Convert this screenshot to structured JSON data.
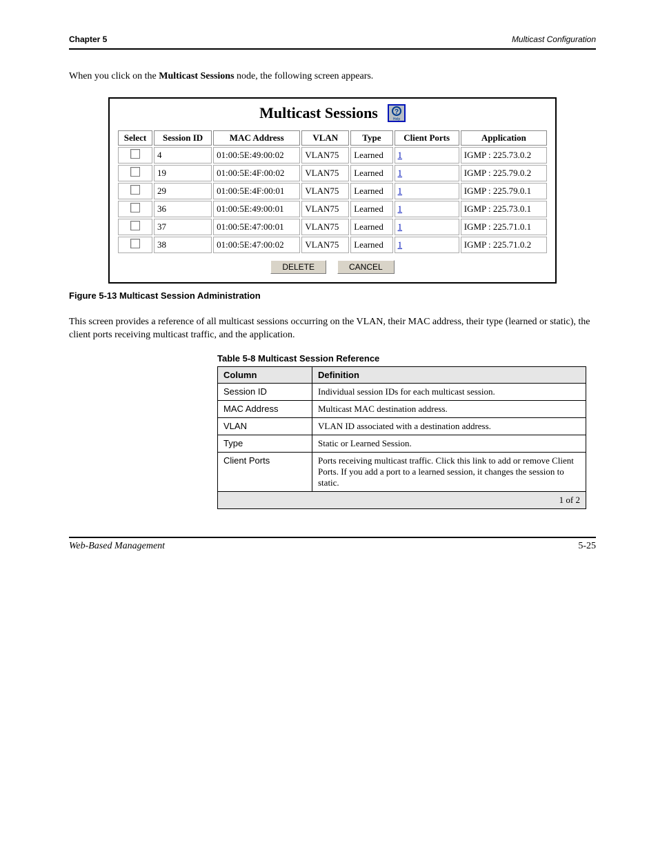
{
  "header": {
    "chapter": "Chapter 5",
    "section": "Multicast Configuration"
  },
  "intro1_a": "When you click on the ",
  "intro1_b": " node, the following screen appears.",
  "multicast_link": "Multicast Sessions",
  "figure": {
    "title": "Multicast Sessions",
    "help_label": "Help",
    "columns": [
      "Select",
      "Session ID",
      "MAC Address",
      "VLAN",
      "Type",
      "Client Ports",
      "Application"
    ],
    "rows": [
      {
        "session_id": "4",
        "mac": "01:00:5E:49:00:02",
        "vlan": "VLAN75",
        "type": "Learned",
        "client_ports": "1",
        "application": "IGMP : 225.73.0.2"
      },
      {
        "session_id": "19",
        "mac": "01:00:5E:4F:00:02",
        "vlan": "VLAN75",
        "type": "Learned",
        "client_ports": "1",
        "application": "IGMP : 225.79.0.2"
      },
      {
        "session_id": "29",
        "mac": "01:00:5E:4F:00:01",
        "vlan": "VLAN75",
        "type": "Learned",
        "client_ports": "1",
        "application": "IGMP : 225.79.0.1"
      },
      {
        "session_id": "36",
        "mac": "01:00:5E:49:00:01",
        "vlan": "VLAN75",
        "type": "Learned",
        "client_ports": "1",
        "application": "IGMP : 225.73.0.1"
      },
      {
        "session_id": "37",
        "mac": "01:00:5E:47:00:01",
        "vlan": "VLAN75",
        "type": "Learned",
        "client_ports": "1",
        "application": "IGMP : 225.71.0.1"
      },
      {
        "session_id": "38",
        "mac": "01:00:5E:47:00:02",
        "vlan": "VLAN75",
        "type": "Learned",
        "client_ports": "1",
        "application": "IGMP : 225.71.0.2"
      }
    ],
    "buttons": {
      "delete": "DELETE",
      "cancel": "CANCEL"
    }
  },
  "figure_caption_label": "Figure 5-13",
  "figure_caption_text": "  Multicast Session Administration",
  "para2": "This screen provides a reference of all multicast sessions occurring on the VLAN, their MAC address, their type (learned or static), the client ports receiving multicast traffic, and the application.",
  "ref_caption_label": "Table 5-8",
  "ref_caption_text": "  Multicast Session Reference",
  "ref_table": {
    "head": [
      "Column",
      "Definition"
    ],
    "rows": [
      [
        "Session ID",
        "Individual session IDs for each multicast session."
      ],
      [
        "MAC Address",
        "Multicast MAC destination address."
      ],
      [
        "VLAN",
        "VLAN ID associated with a destination address."
      ],
      [
        "Type",
        "Static or Learned Session."
      ],
      [
        "Client Ports",
        "Ports receiving multicast traffic. Click this link to add or remove Client Ports. If you add a port to a learned session, it changes the session to static."
      ]
    ],
    "foot": "1 of 2"
  },
  "footer": {
    "left": "Web-Based Management",
    "right": "5-25"
  }
}
